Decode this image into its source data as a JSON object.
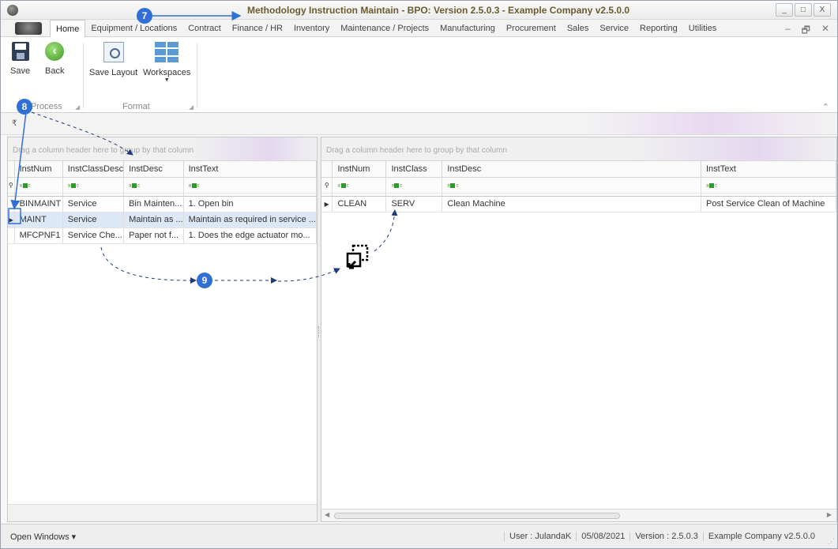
{
  "window": {
    "title_bold": "Methodology Instruction Maintain - BPO: Version 2.5.0.3 - Example Company v2.5.0.0",
    "controls": [
      "_",
      "□",
      "X"
    ]
  },
  "menu": {
    "tabs": [
      "Home",
      "Equipment / Locations",
      "Contract",
      "Finance / HR",
      "Inventory",
      "Maintenance / Projects",
      "Manufacturing",
      "Procurement",
      "Sales",
      "Service",
      "Reporting",
      "Utilities"
    ],
    "right_controls": [
      "–",
      "🗗",
      "✕"
    ]
  },
  "ribbon": {
    "save": "Save",
    "back": "Back",
    "save_layout": "Save Layout",
    "workspaces": "Workspaces",
    "group_process": "Process",
    "group_format": "Format"
  },
  "left_grid": {
    "group_hint": "Drag a column header here to group by that column",
    "columns": [
      "InstNum",
      "InstClassDesc",
      "InstDesc",
      "InstText"
    ],
    "rows": [
      [
        "BINMAINT",
        "Service",
        "Bin Mainten...",
        "1. Open bin"
      ],
      [
        "MAINT",
        "Service",
        "Maintain as ...",
        "Maintain as required in service ..."
      ],
      [
        "MFCPNF1",
        "Service Che...",
        "Paper not f...",
        "1. Does the edge actuator mo..."
      ]
    ]
  },
  "right_grid": {
    "group_hint": "Drag a column header here to group by that column",
    "columns": [
      "InstNum",
      "InstClass",
      "InstDesc",
      "InstText"
    ],
    "rows": [
      [
        "CLEAN",
        "SERV",
        "Clean Machine",
        "Post Service Clean of Machine"
      ]
    ]
  },
  "status": {
    "open_windows": "Open Windows ▾",
    "user": "User : JulandaK",
    "date": "05/08/2021",
    "version": "Version : 2.5.0.3",
    "company": "Example Company v2.5.0.0"
  },
  "annotations": {
    "step7": "7",
    "step8": "8",
    "step9": "9",
    "accent_color": "#2f6fd6"
  }
}
